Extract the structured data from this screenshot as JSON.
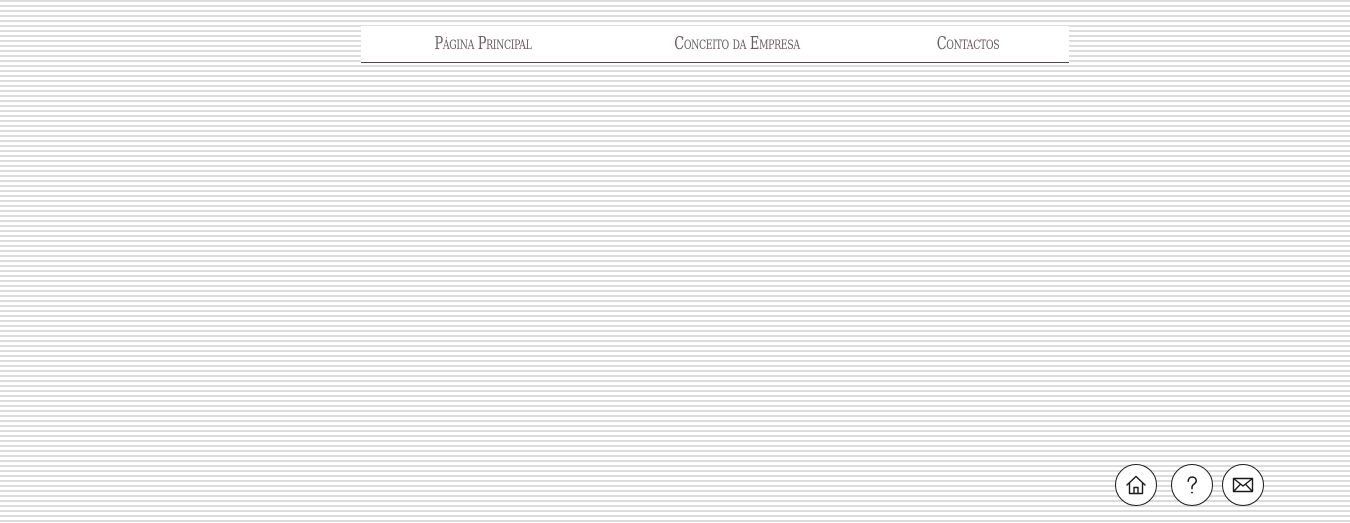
{
  "nav": {
    "items": [
      {
        "label": "Página Principal"
      },
      {
        "label": "Conceito da Empresa"
      },
      {
        "label": "Contactos"
      }
    ]
  },
  "footer_icons": [
    {
      "icon": "home-icon"
    },
    {
      "icon": "question-icon"
    },
    {
      "icon": "mail-icon"
    }
  ],
  "colors": {
    "nav_text": "#6b5a5e",
    "nav_border": "#5a4448",
    "stripe": "#dcdcdc",
    "background": "#ffffff",
    "icon_stroke": "#1a1a1a"
  }
}
